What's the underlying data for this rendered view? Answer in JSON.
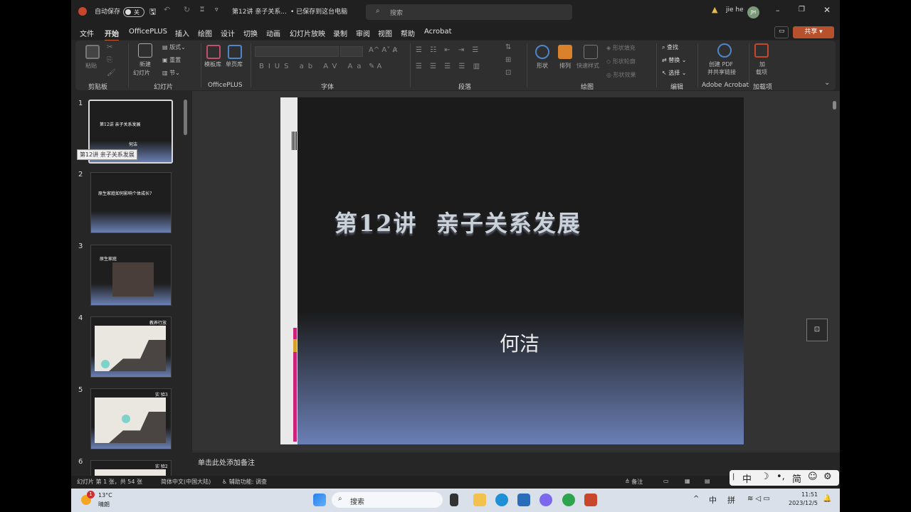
{
  "window": {
    "autosave_label": "自动保存",
    "autosave_state": "关",
    "doc_title": "第12讲 亲子关系...",
    "save_status": "• 已保存到这台电脑",
    "search_placeholder": "搜索",
    "user_name": "jie he",
    "user_initials": "JH"
  },
  "menu": {
    "items": [
      "文件",
      "开始",
      "OfficePLUS",
      "插入",
      "绘图",
      "设计",
      "切换",
      "动画",
      "幻灯片放映",
      "录制",
      "审阅",
      "视图",
      "帮助",
      "Acrobat"
    ],
    "active": "开始",
    "share_label": "共享"
  },
  "ribbon": {
    "groups": {
      "clipboard": "剪贴板",
      "slides": "幻灯片",
      "officeplus": "OfficePLUS",
      "font": "字体",
      "paragraph": "段落",
      "drawing": "绘图",
      "editing": "编辑",
      "acrobat": "Adobe Acrobat",
      "addins": "加载项"
    },
    "buttons": {
      "paste": "粘贴",
      "new_slide_1": "新建",
      "new_slide_2": "幻灯片",
      "layout": "版式",
      "reset": "重置",
      "section": "节",
      "template_lib": "模板库",
      "single_page_lib": "单页库",
      "shapes": "形状",
      "arrange": "排列",
      "quick_styles": "快速样式",
      "shape_fill": "形状填充",
      "shape_outline": "形状轮廓",
      "shape_effects": "形状效果",
      "find": "查找",
      "replace": "替换",
      "select": "选择",
      "create_pdf_1": "创建 PDF",
      "create_pdf_2": "并共享链接",
      "addin_1": "加",
      "addin_2": "载项"
    }
  },
  "thumbnails": [
    {
      "num": "1",
      "title": "第12讲 亲子关系发展",
      "sub": "何洁"
    },
    {
      "num": "2",
      "title": "原生家庭如何影响个体成长?"
    },
    {
      "num": "3",
      "title": "原生家庭"
    },
    {
      "num": "4",
      "title": "教养行放"
    },
    {
      "num": "5",
      "title": "实 验3"
    },
    {
      "num": "6",
      "title": "实 验2"
    }
  ],
  "tooltip": "第12讲 亲子关系发展",
  "slide": {
    "title": "第12讲  亲子关系发展",
    "subtitle": "何洁"
  },
  "notes_placeholder": "单击此处添加备注",
  "status": {
    "slide_info": "幻灯片 第 1 张，共 54 张",
    "language": "简体中文(中国大陆)",
    "accessibility": "辅助功能: 调查",
    "notes_btn": "备注"
  },
  "ime": {
    "mode": "中",
    "simplified": "简"
  },
  "taskbar": {
    "temperature": "13°C",
    "weather": "晴朗",
    "notification_count": "1",
    "search_label": "搜索",
    "lang1": "中",
    "lang2": "拼",
    "time": "11:51",
    "date": "2023/12/5"
  },
  "colors": {
    "accent": "#b6502d",
    "slide_gradient_end": "#6a7fb5",
    "slide_pink_bar": "#cc2277"
  }
}
